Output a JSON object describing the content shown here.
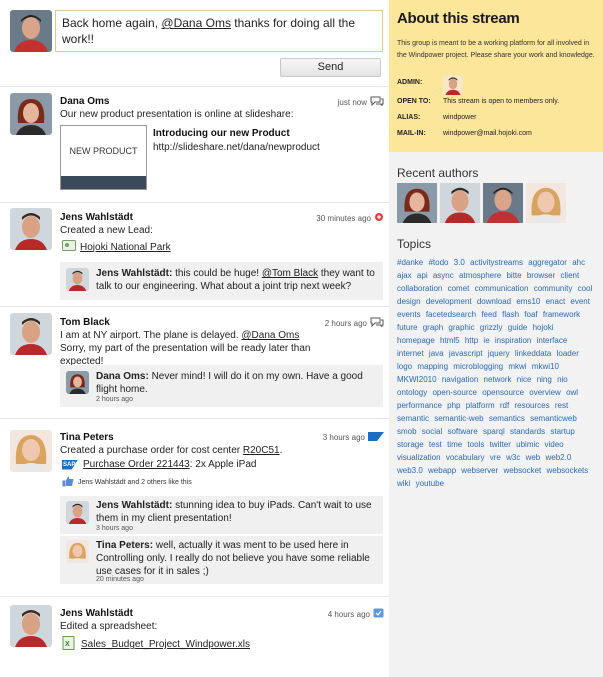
{
  "composer": {
    "text_before": "Back home again, ",
    "mention": "@Dana Oms",
    "text_after": " thanks for doing all the work!!",
    "send_label": "Send"
  },
  "posts": [
    {
      "author": "Dana Oms",
      "text": "Our new product presentation is online at slideshare:",
      "time": "just now",
      "attachment_title": "Introducing our new Product",
      "attachment_url": "http://slideshare.net/dana/newproduct",
      "thumb_label": "NEW PRODUCT"
    },
    {
      "author": "Jens Wahlstädt",
      "text": "Created a new Lead:",
      "time": "30 minutes ago",
      "link": "Hojoki National Park",
      "comment": {
        "author": "Jens Wahlstädt:",
        "text_before": " this could be huge! ",
        "mention": "@Tom Black",
        "text_after": " they want to talk to our engineering. What about a joint trip next week?"
      }
    },
    {
      "author": "Tom Black",
      "text_before": "I am at NY airport. The plane is delayed. ",
      "mention": "@Dana Oms",
      "text_after": " Sorry, my part of the presentation will be ready later than expected!",
      "time": "2 hours ago",
      "comment": {
        "author": "Dana Oms:",
        "text": " Never mind! I will do it on my own. Have a good flight home.",
        "time": "2 hours ago"
      }
    },
    {
      "author": "Tina Peters",
      "text_before": "Created a purchase order for cost center ",
      "cost_center": "R20C51",
      "text_after": ".",
      "time": "3 hours ago",
      "sap_label": "SAP",
      "po_link": "Purchase Order 221443",
      "po_rest": ": 2x Apple iPad",
      "likes": "Jens Wahlstädt and 2 others like this",
      "comments": [
        {
          "author": "Jens Wahlstädt:",
          "text": " stunning idea to buy iPads. Can't wait to use them in my client presentation!",
          "time": "3 hours ago"
        },
        {
          "author": "Tina Peters:",
          "text": " well, actually it was ment to be used here in Controlling only. I really do not believe you have some reliable use cases for it in sales ;)",
          "time": "20 minutes ago"
        }
      ]
    },
    {
      "author": "Jens Wahlstädt",
      "text": "Edited a spreadsheet:",
      "time": "4 hours ago",
      "file": "Sales_Budget_Project_Windpower.xls"
    }
  ],
  "about": {
    "title": "About this stream",
    "description": "This group is meant to be a working platform for all involved in the Windpower project. Please share your work and knowledge.",
    "admin_label": "ADMIN:",
    "open_label": "OPEN TO:",
    "open_value": "This stream is open to members only.",
    "alias_label": "ALIAS:",
    "alias_value": "windpower",
    "mail_label": "MAIL-IN:",
    "mail_value": "windpower@mail.hojoki.com"
  },
  "recent_authors_title": "Recent authors",
  "topics_title": "Topics",
  "topics": [
    "#danke",
    "#todo",
    "3.0",
    "activitystreams",
    "aggregator",
    "ahc",
    "ajax",
    "api",
    "async",
    "atmosphere",
    "bitte",
    "browser",
    "client",
    "collaboration",
    "comet",
    "communication",
    "community",
    "cool",
    "design",
    "development",
    "download",
    "ems10",
    "enact",
    "event",
    "events",
    "facetedsearch",
    "feed",
    "flash",
    "foaf",
    "framework",
    "future",
    "graph",
    "graphic",
    "grizzly",
    "guide",
    "hojoki",
    "homepage",
    "html5",
    "http",
    "ie",
    "inspiration",
    "interface",
    "internet",
    "java",
    "javascript",
    "jquery",
    "linkeddata",
    "loader",
    "logo",
    "mapping",
    "microblogging",
    "mkwi",
    "mkwi10",
    "MKWI2010",
    "navigation",
    "network",
    "nice",
    "ning",
    "nio",
    "ontology",
    "open-source",
    "opensource",
    "overview",
    "owl",
    "performance",
    "php",
    "platform",
    "rdf",
    "resources",
    "rest",
    "semantic",
    "semantic-web",
    "semantics",
    "semanticweb",
    "smob",
    "social",
    "software",
    "sparql",
    "standards",
    "startup",
    "storage",
    "test",
    "time",
    "tools",
    "twitter",
    "ubimic",
    "video",
    "visualization",
    "vocabulary",
    "vre",
    "w3c",
    "web",
    "web2.0",
    "web3.0",
    "webapp",
    "webserver",
    "websocket",
    "websockets",
    "wiki",
    "youtube"
  ],
  "colors": {
    "about_bg": "#fbe69a",
    "tag_link": "#2a6ab0",
    "panel_bg": "#f2f2f2",
    "sap_blue": "#1a6fc4"
  }
}
